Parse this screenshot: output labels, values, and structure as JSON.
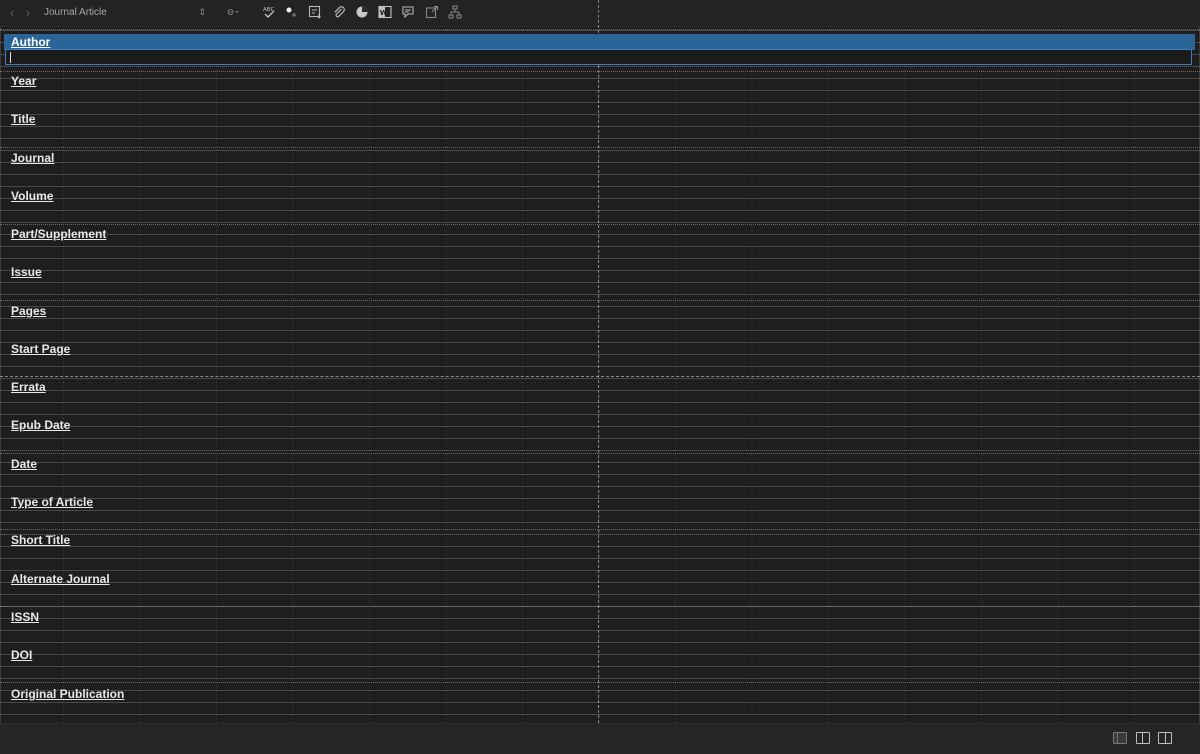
{
  "toolbar": {
    "back_icon": "chevron-left-icon",
    "forward_icon": "chevron-right-icon",
    "reference_type": "Journal Article",
    "icons": [
      "minus-circle-icon",
      "spellcheck-icon",
      "insert-symbol-icon",
      "insert-text-icon",
      "attach-file-icon",
      "figure-icon",
      "word-icon",
      "edit-note-icon",
      "open-link-icon",
      "hierarchy-icon"
    ]
  },
  "fields": [
    {
      "label": "Author",
      "value": ""
    },
    {
      "label": "Year",
      "value": ""
    },
    {
      "label": "Title",
      "value": ""
    },
    {
      "label": "Journal",
      "value": ""
    },
    {
      "label": "Volume",
      "value": ""
    },
    {
      "label": "Part/Supplement",
      "value": ""
    },
    {
      "label": "Issue",
      "value": ""
    },
    {
      "label": "Pages",
      "value": ""
    },
    {
      "label": "Start Page",
      "value": ""
    },
    {
      "label": "Errata",
      "value": ""
    },
    {
      "label": "Epub Date",
      "value": ""
    },
    {
      "label": "Date",
      "value": ""
    },
    {
      "label": "Type of Article",
      "value": ""
    },
    {
      "label": "Short Title",
      "value": ""
    },
    {
      "label": "Alternate Journal",
      "value": ""
    },
    {
      "label": "ISSN",
      "value": ""
    },
    {
      "label": "DOI",
      "value": ""
    },
    {
      "label": "Original Publication",
      "value": ""
    }
  ],
  "colors": {
    "background": "#1e1e1e",
    "selected_field": "#2b6497",
    "edit_border": "#3e7fbb",
    "label_text": "#e8e8e8"
  },
  "statusbar": {
    "views": [
      "layout-single-icon",
      "layout-split-icon",
      "layout-panel-icon"
    ]
  }
}
